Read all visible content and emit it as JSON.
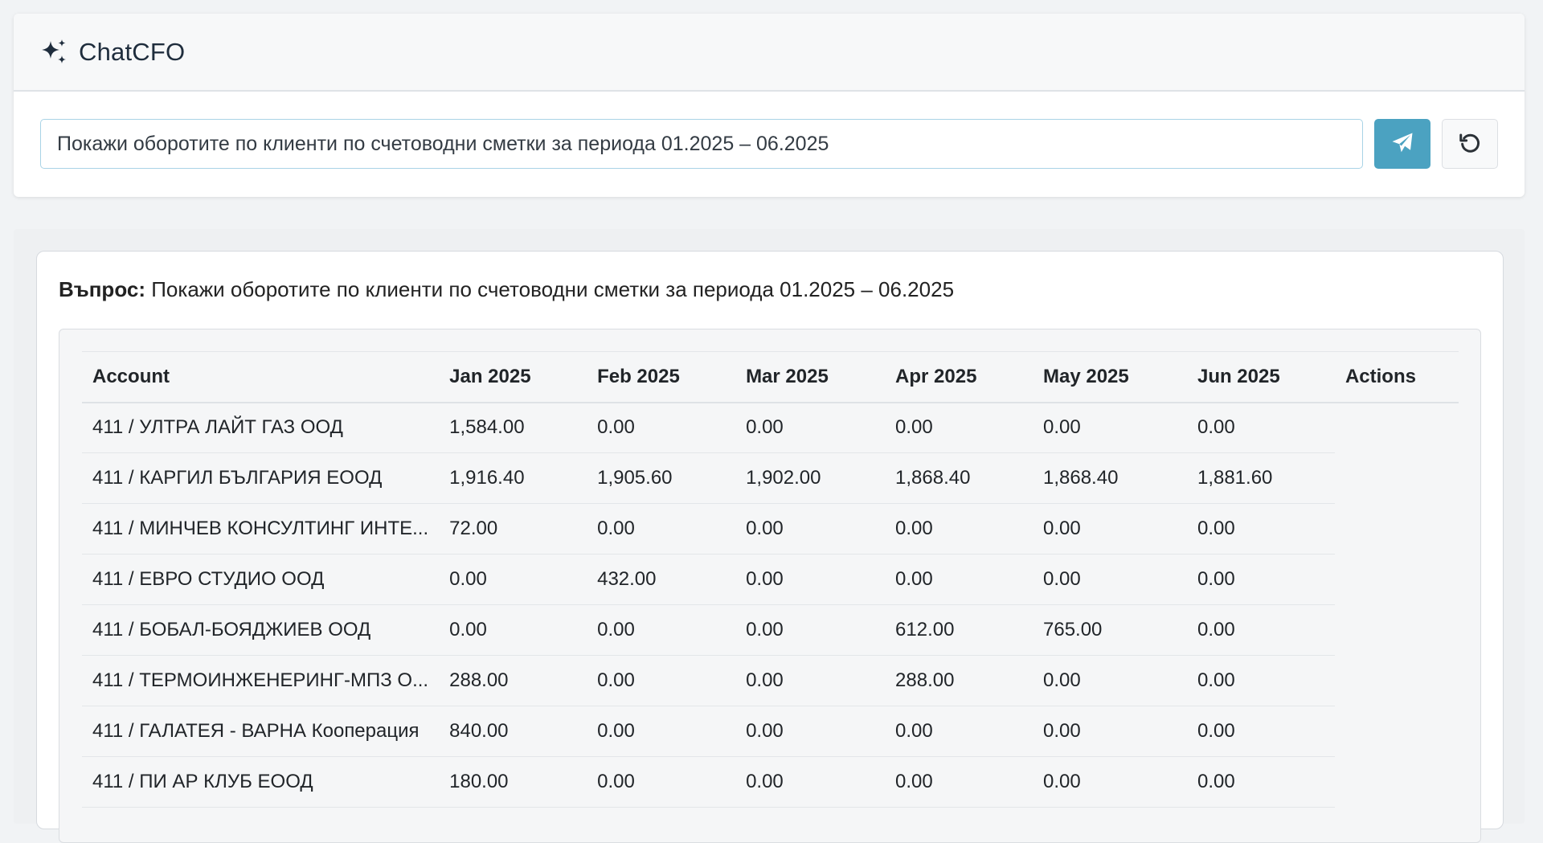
{
  "app": {
    "title": "ChatCFO",
    "logo_icon": "sparkles-icon"
  },
  "query": {
    "value": "Покажи оборотите по клиенти по счетоводни сметки за периода 01.2025 – 06.2025",
    "send_icon": "paper-plane-icon",
    "reset_icon": "rotate-left-icon"
  },
  "answer": {
    "question_label": "Въпрос:",
    "question_text": "Покажи оборотите по клиенти по счетоводни сметки за периода 01.2025 – 06.2025",
    "columns": [
      "Account",
      "Jan 2025",
      "Feb 2025",
      "Mar 2025",
      "Apr 2025",
      "May 2025",
      "Jun 2025",
      "Actions"
    ],
    "rows": [
      [
        "411 / УЛТРА ЛАЙТ ГАЗ ООД",
        "1,584.00",
        "0.00",
        "0.00",
        "0.00",
        "0.00",
        "0.00"
      ],
      [
        "411 / КАРГИЛ БЪЛГАРИЯ ЕООД",
        "1,916.40",
        "1,905.60",
        "1,902.00",
        "1,868.40",
        "1,868.40",
        "1,881.60"
      ],
      [
        "411 / МИНЧЕВ КОНСУЛТИНГ ИНТЕ...",
        "72.00",
        "0.00",
        "0.00",
        "0.00",
        "0.00",
        "0.00"
      ],
      [
        "411 / ЕВРО СТУДИО ООД",
        "0.00",
        "432.00",
        "0.00",
        "0.00",
        "0.00",
        "0.00"
      ],
      [
        "411 / БОБАЛ-БОЯДЖИЕВ ООД",
        "0.00",
        "0.00",
        "0.00",
        "612.00",
        "765.00",
        "0.00"
      ],
      [
        "411 / ТЕРМОИНЖЕНЕРИНГ-МПЗ О...",
        "288.00",
        "0.00",
        "0.00",
        "288.00",
        "0.00",
        "0.00"
      ],
      [
        "411 / ГАЛАТЕЯ - ВАРНА Кооперация",
        "840.00",
        "0.00",
        "0.00",
        "0.00",
        "0.00",
        "0.00"
      ],
      [
        "411 / ПИ АР КЛУБ ЕООД",
        "180.00",
        "0.00",
        "0.00",
        "0.00",
        "0.00",
        "0.00"
      ]
    ]
  },
  "colors": {
    "accent": "#4ba2c1",
    "input_border": "#a9d3e6"
  }
}
